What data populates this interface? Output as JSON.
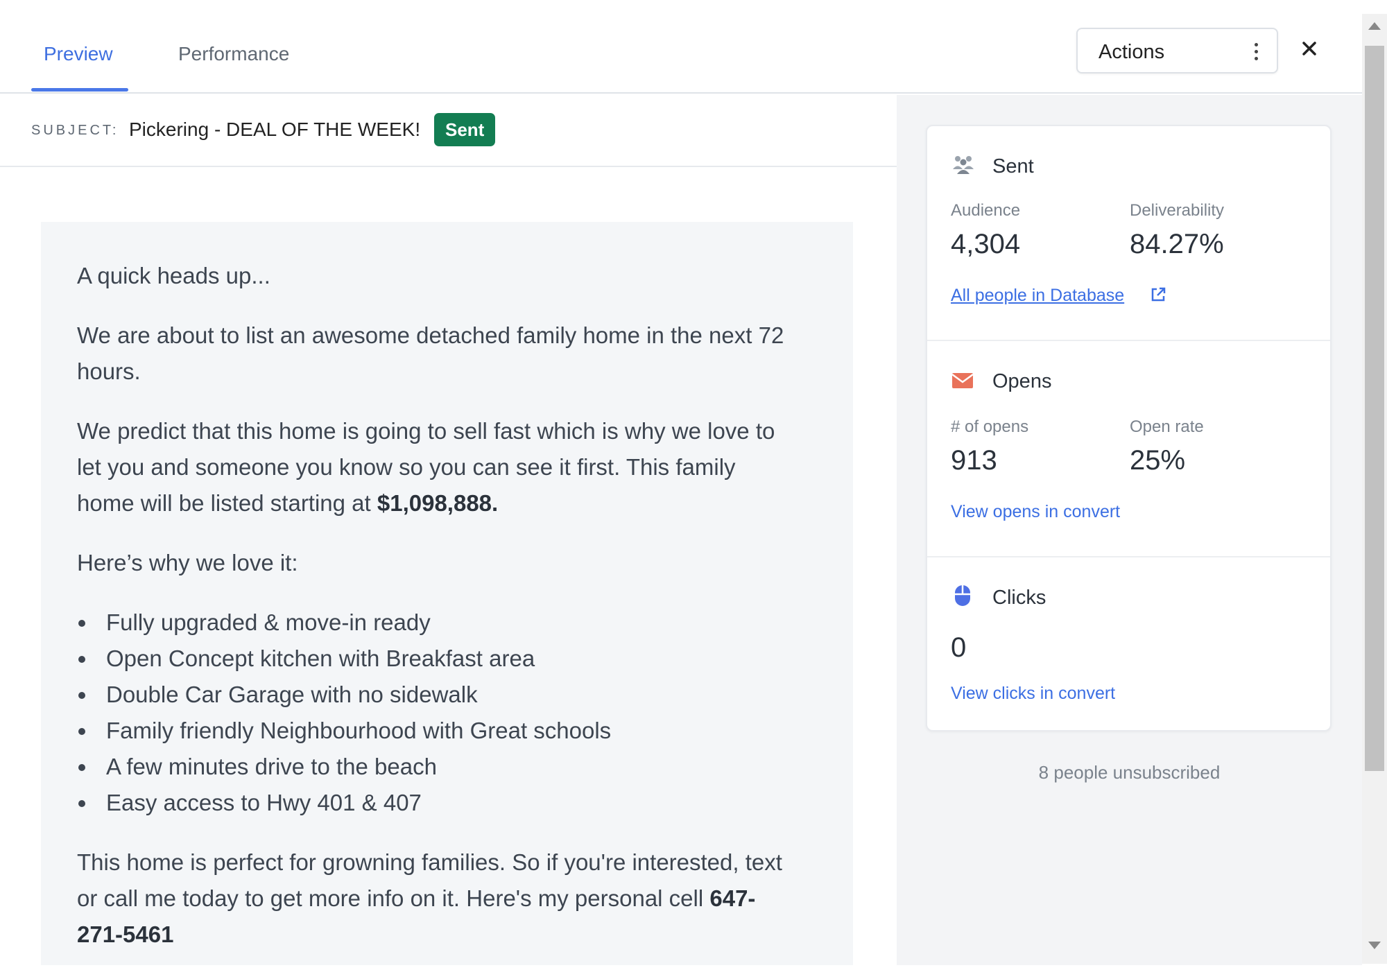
{
  "tabs": [
    {
      "label": "Preview",
      "active": true
    },
    {
      "label": "Performance",
      "active": false
    }
  ],
  "actions": {
    "label": "Actions"
  },
  "subject": {
    "label": "SUBJECT:",
    "text": "Pickering - DEAL OF THE WEEK!",
    "status_badge": "Sent"
  },
  "email": {
    "p1": "A quick heads up...",
    "p2": "We are about to list an awesome detached family home in the next 72 hours.",
    "p3_text": "We predict that this home is going to sell fast which is why we love to let you and someone you know so you can see it first. This family home will be listed starting at ",
    "p3_price": "$1,098,888.",
    "p4": "Here’s why we love it:",
    "bullets": [
      "Fully upgraded & move-in ready",
      "Open Concept kitchen with Breakfast area",
      "Double Car Garage with no sidewalk",
      "Family friendly Neighbourhood with Great schools",
      "A few minutes drive to the beach",
      "Easy access to Hwy 401 & 407"
    ],
    "p5_text": "This home is perfect for growning families. So if you're interested, text or call me today to get more info on it. Here's my personal cell ",
    "p5_phone": "647-271-5461"
  },
  "stats": {
    "sent": {
      "title": "Sent",
      "audience_label": "Audience",
      "audience_value": "4,304",
      "deliverability_label": "Deliverability",
      "deliverability_value": "84.27%",
      "link": "All people in Database"
    },
    "opens": {
      "title": "Opens",
      "count_label": "# of opens",
      "count_value": "913",
      "rate_label": "Open rate",
      "rate_value": "25%",
      "link": "View opens in convert"
    },
    "clicks": {
      "title": "Clicks",
      "value": "0",
      "link": "View clicks in convert"
    }
  },
  "unsubscribed": "8 people unsubscribed",
  "colors": {
    "accent": "#3e6fe0",
    "sent_badge": "#137d52",
    "opens_icon": "#e9725a",
    "clicks_icon": "#4e6fe4"
  }
}
